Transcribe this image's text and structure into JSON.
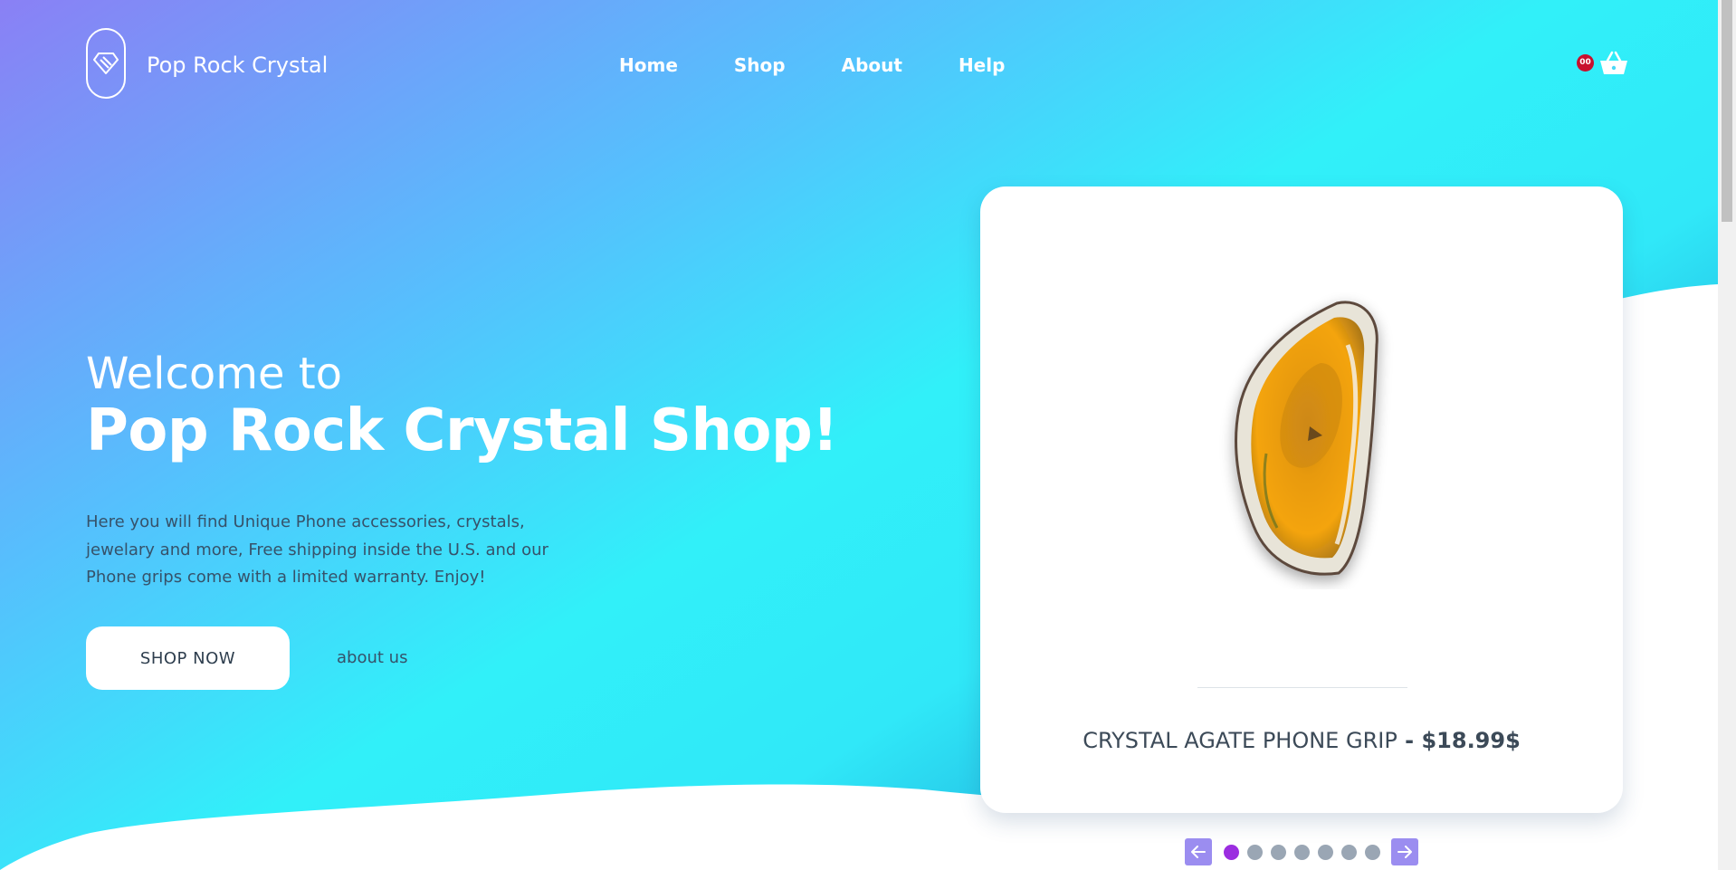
{
  "header": {
    "brand": "Pop Rock Crystal",
    "nav": [
      "Home",
      "Shop",
      "About",
      "Help"
    ],
    "cart_count": "00"
  },
  "hero": {
    "welcome": "Welcome to",
    "headline": "Pop Rock Crystal Shop!",
    "description": "Here you will find Unique Phone accessories, crystals, jewelary and more, Free shipping inside the U.S. and our Phone grips come with a limited warranty. Enjoy!",
    "shop_button": "SHOP NOW",
    "about_link": "about us"
  },
  "product": {
    "name": "CRYSTAL AGATE PHONE GRIP",
    "separator": " - ",
    "price": "$18.99$",
    "image_icon": "agate-slice-icon"
  },
  "carousel": {
    "slide_count": 7,
    "active_index": 0,
    "prev_icon": "arrow-left-icon",
    "next_icon": "arrow-right-icon"
  },
  "colors": {
    "gradient_start": "#8a80f5",
    "gradient_mid": "#31f0f9",
    "gradient_end": "#1889cc",
    "badge": "#c8102e",
    "dot_active": "#9b2de0",
    "dot": "#9aa6b4",
    "arrow_bg": "#9b8df0"
  }
}
